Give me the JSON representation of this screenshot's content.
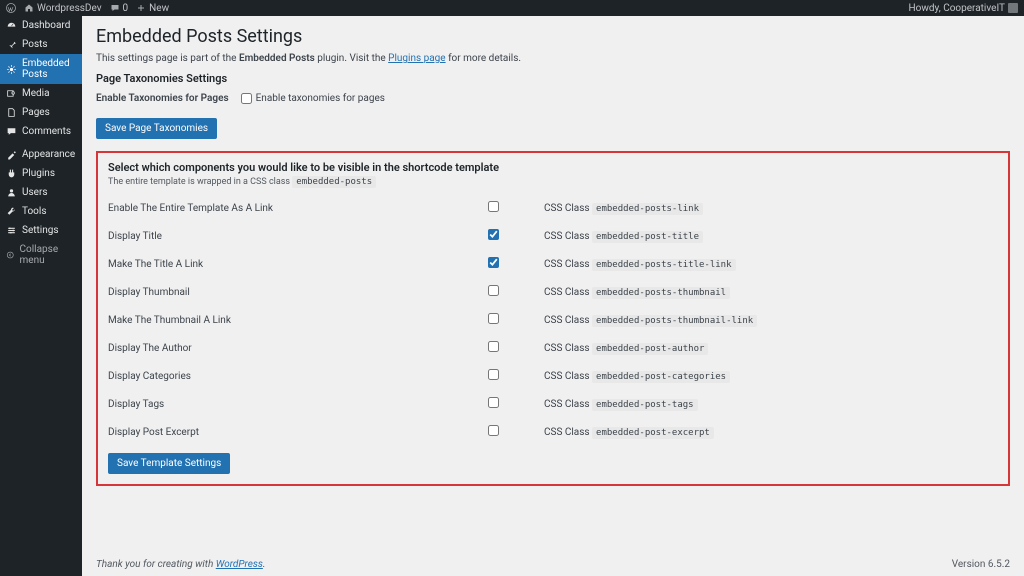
{
  "adminbar": {
    "site_name": "WordpressDev",
    "comments": "0",
    "new": "New",
    "howdy": "Howdy, CooperativeIT"
  },
  "sidebar": {
    "items": [
      {
        "icon": "dashboard",
        "label": "Dashboard"
      },
      {
        "icon": "pin",
        "label": "Posts"
      },
      {
        "icon": "admin-generic",
        "label": "Embedded Posts",
        "current": true
      },
      {
        "icon": "media",
        "label": "Media"
      },
      {
        "icon": "page",
        "label": "Pages"
      },
      {
        "icon": "comments",
        "label": "Comments"
      }
    ],
    "items2": [
      {
        "icon": "appearance",
        "label": "Appearance"
      },
      {
        "icon": "plugins",
        "label": "Plugins"
      },
      {
        "icon": "users",
        "label": "Users"
      },
      {
        "icon": "tools",
        "label": "Tools"
      },
      {
        "icon": "settings",
        "label": "Settings"
      }
    ],
    "collapse": "Collapse menu"
  },
  "page": {
    "title": "Embedded Posts Settings",
    "intro_prefix": "This settings page is part of the ",
    "intro_bold": "Embedded Posts",
    "intro_mid": " plugin. Visit the ",
    "intro_link": "Plugins page",
    "intro_suffix": " for more details.",
    "taxonomies_heading": "Page Taxonomies Settings",
    "taxonomy_label": "Enable Taxonomies for Pages",
    "taxonomy_checkbox_label": "Enable taxonomies for pages",
    "save_taxonomies": "Save Page Taxonomies",
    "template_heading": "Select which components you would like to be visible in the shortcode template",
    "template_sub_prefix": "The entire template is wrapped in a CSS class ",
    "template_sub_code": "embedded-posts",
    "css_class_label": "CSS Class",
    "options": [
      {
        "label": "Enable The Entire Template As A Link",
        "checked": false,
        "class": "embedded-posts-link"
      },
      {
        "label": "Display Title",
        "checked": true,
        "class": "embedded-post-title"
      },
      {
        "label": "Make The Title A Link",
        "checked": true,
        "class": "embedded-posts-title-link"
      },
      {
        "label": "Display Thumbnail",
        "checked": false,
        "class": "embedded-posts-thumbnail"
      },
      {
        "label": "Make The Thumbnail A Link",
        "checked": false,
        "class": "embedded-posts-thumbnail-link"
      },
      {
        "label": "Display The Author",
        "checked": false,
        "class": "embedded-post-author"
      },
      {
        "label": "Display Categories",
        "checked": false,
        "class": "embedded-post-categories"
      },
      {
        "label": "Display Tags",
        "checked": false,
        "class": "embedded-post-tags"
      },
      {
        "label": "Display Post Excerpt",
        "checked": false,
        "class": "embedded-post-excerpt"
      }
    ],
    "save_template": "Save Template Settings"
  },
  "footer": {
    "thanks_prefix": "Thank you for creating with ",
    "thanks_link": "WordPress",
    "thanks_suffix": ".",
    "version": "Version 6.5.2"
  }
}
